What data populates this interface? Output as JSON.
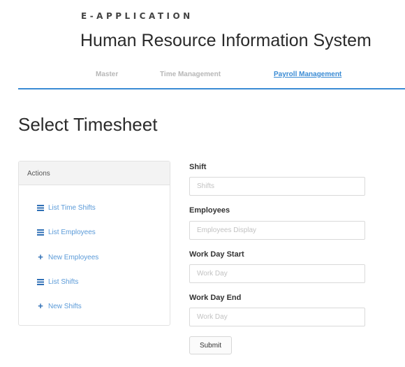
{
  "header": {
    "app_kicker": "E-APPLICATION",
    "app_title": "Human Resource Information System"
  },
  "nav": {
    "items": [
      {
        "label": "Master",
        "active": false
      },
      {
        "label": "Time Management",
        "active": false
      },
      {
        "label": "Payroll Management",
        "active": true
      }
    ]
  },
  "page": {
    "title": "Select Timesheet"
  },
  "actions": {
    "header": "Actions",
    "items": [
      {
        "label": "List Time Shifts",
        "icon": "list-icon"
      },
      {
        "label": "List Employees",
        "icon": "list-icon"
      },
      {
        "label": "New Employees",
        "icon": "plus-icon"
      },
      {
        "label": "List Shifts",
        "icon": "list-icon"
      },
      {
        "label": "New Shifts",
        "icon": "plus-icon"
      }
    ]
  },
  "form": {
    "fields": [
      {
        "label": "Shift",
        "placeholder": "Shifts"
      },
      {
        "label": "Employees",
        "placeholder": "Employees Display"
      },
      {
        "label": "Work Day Start",
        "placeholder": "Work Day"
      },
      {
        "label": "Work Day End",
        "placeholder": "Work Day"
      }
    ],
    "submit_label": "Submit"
  },
  "colors": {
    "accent": "#3a8bd4",
    "link": "#5a9ad8",
    "icon": "#2f6fb5"
  }
}
